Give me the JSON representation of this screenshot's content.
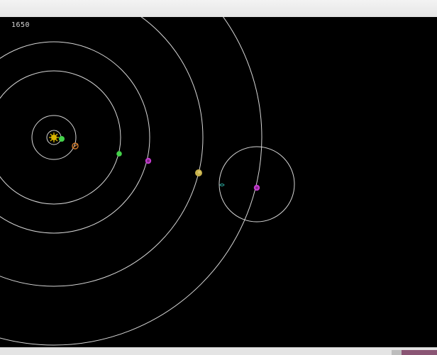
{
  "simulation": {
    "counter": "1650",
    "colors": {
      "background": "#000000",
      "orbit": "#d8d8d8",
      "sun": "#d8b400",
      "planet_green": "#44d24a",
      "planet_orange": "#d07a2c",
      "planet_magenta": "#c23bcc",
      "planet_yellow": "#c8b24c",
      "moon_teal": "#2aa59a"
    },
    "bodies": [
      {
        "name": "sun",
        "icon": "sun-icon"
      },
      {
        "name": "inner-green-planet",
        "icon": "green-planet-icon"
      },
      {
        "name": "orange-planet",
        "icon": "orange-planet-icon"
      },
      {
        "name": "green-planet",
        "icon": "green-planet-icon"
      },
      {
        "name": "magenta-planet",
        "icon": "magenta-planet-icon"
      },
      {
        "name": "yellow-planet",
        "icon": "yellow-planet-icon"
      },
      {
        "name": "outer-magenta-planet",
        "icon": "magenta-planet-icon"
      },
      {
        "name": "teal-moon",
        "icon": "teal-moon-icon"
      }
    ]
  }
}
